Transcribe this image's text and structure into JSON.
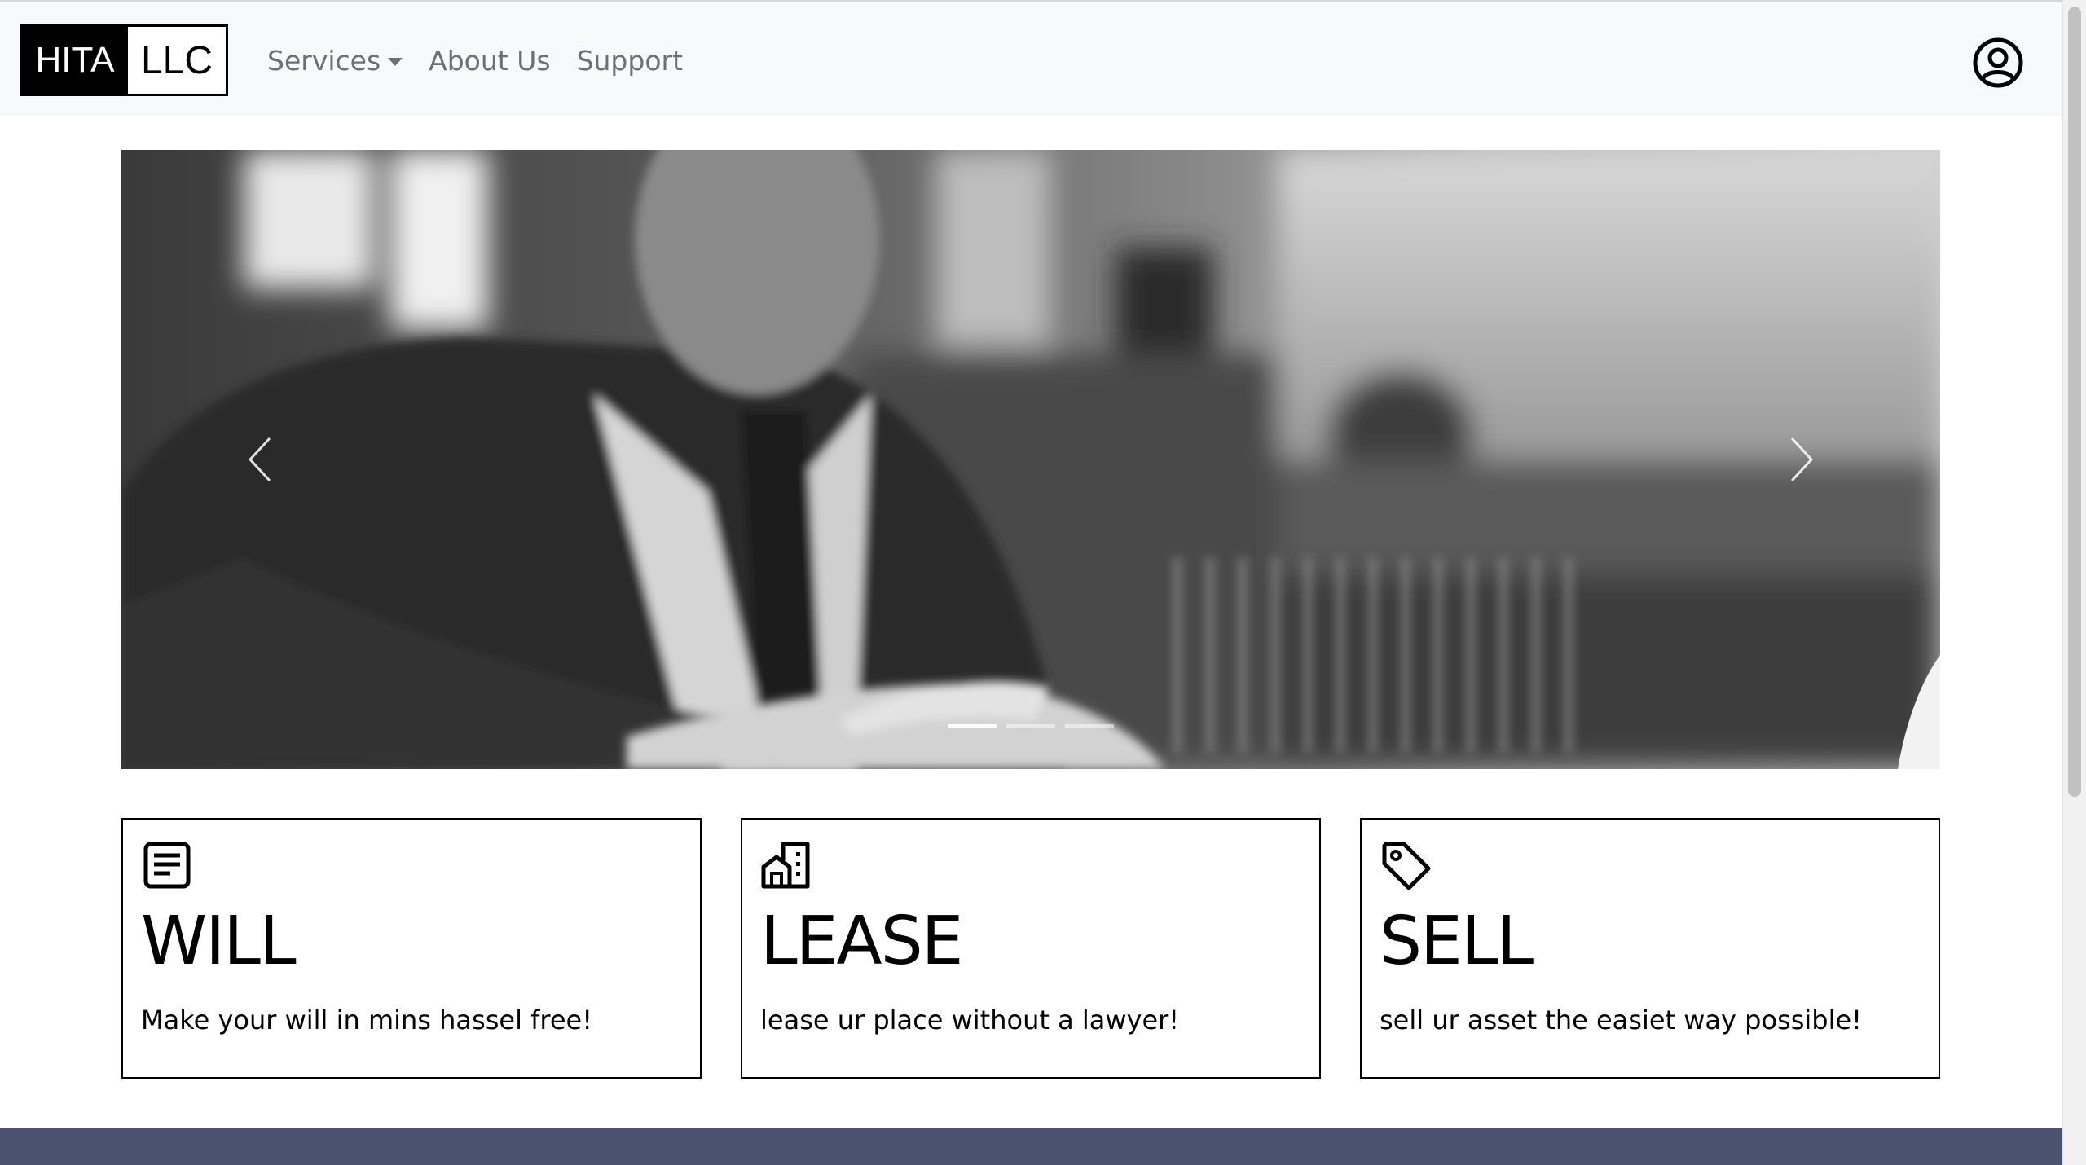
{
  "brand": {
    "left": "HITA",
    "right": "LLC"
  },
  "nav": {
    "services": "Services",
    "about": "About Us",
    "support": "Support"
  },
  "icons": {
    "account": "account-circle-icon",
    "prev": "chevron-left-icon",
    "next": "chevron-right-icon",
    "will": "document-icon",
    "lease": "buildings-icon",
    "sell": "tag-icon"
  },
  "carousel": {
    "slide_count": 3,
    "active_index": 0
  },
  "cards": [
    {
      "title": "WILL",
      "text": "Make your will in mins hassel free!"
    },
    {
      "title": "LEASE",
      "text": "lease ur place without a lawyer!"
    },
    {
      "title": "SELL",
      "text": "sell ur asset the easiet way possible!"
    }
  ],
  "colors": {
    "navbar_bg": "#f8f9fa",
    "nav_text": "#6c6f73",
    "footer_band": "#4a5270",
    "card_border": "#000000"
  }
}
